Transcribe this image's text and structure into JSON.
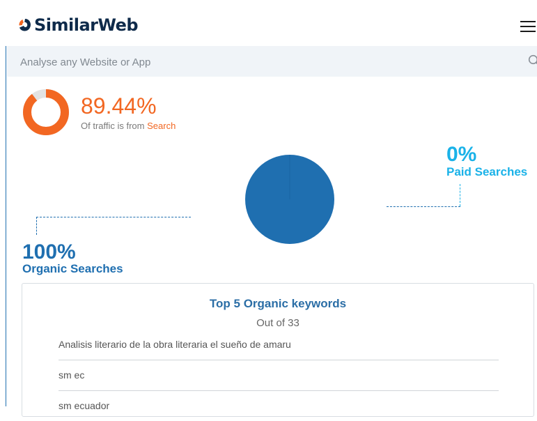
{
  "header": {
    "brand": "SimilarWeb",
    "brand_color": "#0e2a4a",
    "logo_accent": "#f26722",
    "menu_icon": "hamburger-icon"
  },
  "search": {
    "placeholder": "Analyse any Website or App",
    "icon": "search-icon"
  },
  "traffic": {
    "percent_text": "89.44%",
    "percent_value": 89.44,
    "subtitle_prefix": "Of traffic is from ",
    "subtitle_highlight": "Search",
    "accent_color": "#f26722"
  },
  "search_split": {
    "paid": {
      "percent": "0%",
      "label": "Paid Searches",
      "color": "#1ab2e8",
      "value": 0
    },
    "organic": {
      "percent": "100%",
      "label": "Organic Searches",
      "color": "#1f6fb0",
      "value": 100
    }
  },
  "keywords": {
    "title": "Top 5 Organic keywords",
    "subtitle": "Out of 33",
    "items": [
      "Analisis literario de la obra literaria el sueño de amaru",
      "sm ec",
      "sm ecuador"
    ]
  }
}
